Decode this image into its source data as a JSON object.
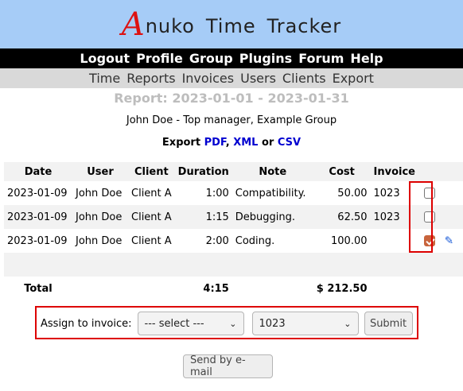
{
  "header": {
    "logo_initial": "A",
    "logo_rest": "nuko",
    "logo_word2": "Time",
    "logo_word3": "Tracker"
  },
  "topnav": [
    "Logout",
    "Profile",
    "Group",
    "Plugins",
    "Forum",
    "Help"
  ],
  "subnav": [
    "Time",
    "Reports",
    "Invoices",
    "Users",
    "Clients",
    "Export"
  ],
  "report": {
    "title": "Report: 2023-01-01 - 2023-01-31",
    "subtitle": "John Doe - Top manager, Example Group",
    "export_label": "Export",
    "export_pdf": "PDF",
    "export_comma": ",",
    "export_xml": "XML",
    "export_or": "or",
    "export_csv": "CSV"
  },
  "table": {
    "headers": [
      "Date",
      "User",
      "Client",
      "Duration",
      "Note",
      "Cost",
      "Invoice"
    ],
    "rows": [
      {
        "date": "2023-01-09",
        "user": "John Doe",
        "client": "Client A",
        "duration": "1:00",
        "note": "Compatibility.",
        "cost": "50.00",
        "invoice": "1023",
        "checked": false
      },
      {
        "date": "2023-01-09",
        "user": "John Doe",
        "client": "Client A",
        "duration": "1:15",
        "note": "Debugging.",
        "cost": "62.50",
        "invoice": "1023",
        "checked": false
      },
      {
        "date": "2023-01-09",
        "user": "John Doe",
        "client": "Client A",
        "duration": "2:00",
        "note": "Coding.",
        "cost": "100.00",
        "invoice": "",
        "checked": true
      }
    ],
    "total_label": "Total",
    "total_duration": "4:15",
    "total_cost": "$ 212.50"
  },
  "assign": {
    "label": "Assign to invoice:",
    "select_value": "--- select ---",
    "invoice_value": "1023",
    "submit_label": "Submit"
  },
  "email_button": "Send by e-mail",
  "colors": {
    "header_bg": "#a6ccf7",
    "highlight": "#dd0000",
    "checkbox_checked": "#c8643c"
  }
}
